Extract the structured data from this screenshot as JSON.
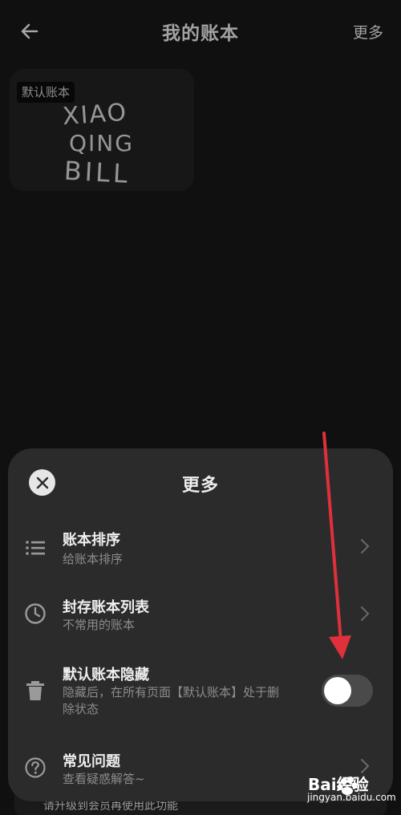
{
  "header": {
    "title": "我的账本",
    "more_label": "更多"
  },
  "book_card": {
    "badge": "默认账本",
    "logo_text": "XIAO QING BILL"
  },
  "sheet": {
    "title": "更多",
    "items": [
      {
        "icon": "list-icon",
        "title": "账本排序",
        "subtitle": "给账本排序",
        "control": "chevron"
      },
      {
        "icon": "clock-icon",
        "title": "封存账本列表",
        "subtitle": "不常用的账本",
        "control": "chevron"
      },
      {
        "icon": "trash-icon",
        "title": "默认账本隐藏",
        "subtitle_line1": "隐藏后，在所有页面【默认账本】处于删",
        "subtitle_line2": "除状态",
        "control": "toggle",
        "toggle_on": false
      },
      {
        "icon": "help-icon",
        "title": "常见问题",
        "subtitle": "查看疑惑解答~",
        "control": "chevron"
      }
    ]
  },
  "bottom_hint": "请升级到会员再使用此功能",
  "watermark": {
    "brand": "Bai经验",
    "url": "jingyan.baidu.com"
  },
  "colors": {
    "background": "#161616",
    "sheet": "#2b2b2b",
    "arrow": "#e0303a",
    "toggle_off": "#4a4a4a"
  }
}
